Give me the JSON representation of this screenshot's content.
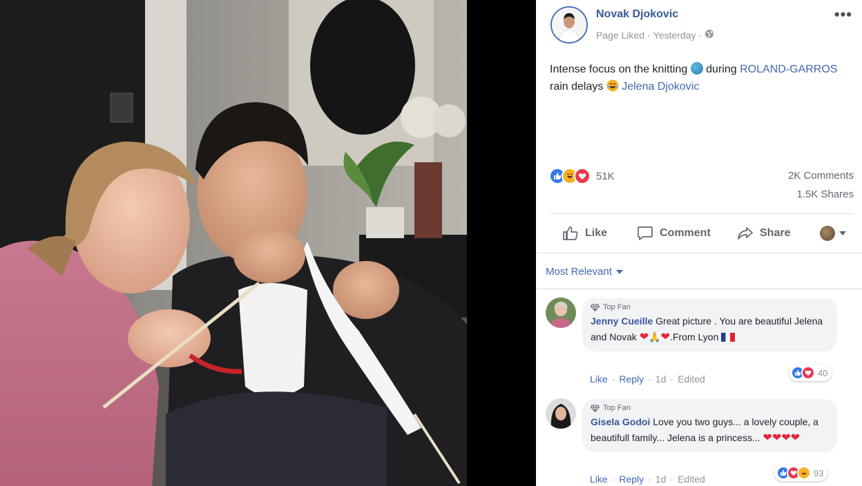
{
  "post": {
    "author": "Novak Djokovic",
    "meta_liked": "Page Liked",
    "meta_sep": "·",
    "meta_time": "Yesterday",
    "meta_sep2": "·",
    "text_before": "Intense focus on the knitting",
    "text_mid": " during ",
    "event_link": "ROLAND-GARROS",
    "text_after": " rain delays ",
    "tag_link": "Jelena Djokovic"
  },
  "stats": {
    "reactions": "51K",
    "comments": "2K Comments",
    "shares": "1.5K Shares"
  },
  "actions": {
    "like": "Like",
    "comment": "Comment",
    "share": "Share"
  },
  "sort": {
    "label": "Most Relevant"
  },
  "comments": [
    {
      "badge": "Top Fan",
      "name": "Jenny Cueille",
      "text1": "Great picture . You are beautiful Jelena and Novak",
      "text2": ".From Lyon",
      "like": "Like",
      "reply": "Reply",
      "time": "1d",
      "edited": "Edited",
      "reactions": "40"
    },
    {
      "badge": "Top Fan",
      "name": "Gisela Godoi",
      "text1": "Love you two guys... a lovely couple, a beautifull family... Jelena is a princess...",
      "like": "Like",
      "reply": "Reply",
      "time": "1d",
      "edited": "Edited",
      "reactions": "93"
    }
  ],
  "icons": [
    "more-icon",
    "globe-icon",
    "like-icon",
    "haha-icon",
    "love-icon",
    "comment-icon",
    "share-icon",
    "caret-down-icon",
    "top-fan-icon"
  ],
  "colors": {
    "link": "#4267b2",
    "name": "#385898",
    "like": "#3578e5",
    "love": "#e9384e",
    "haha": "#f7b125"
  }
}
